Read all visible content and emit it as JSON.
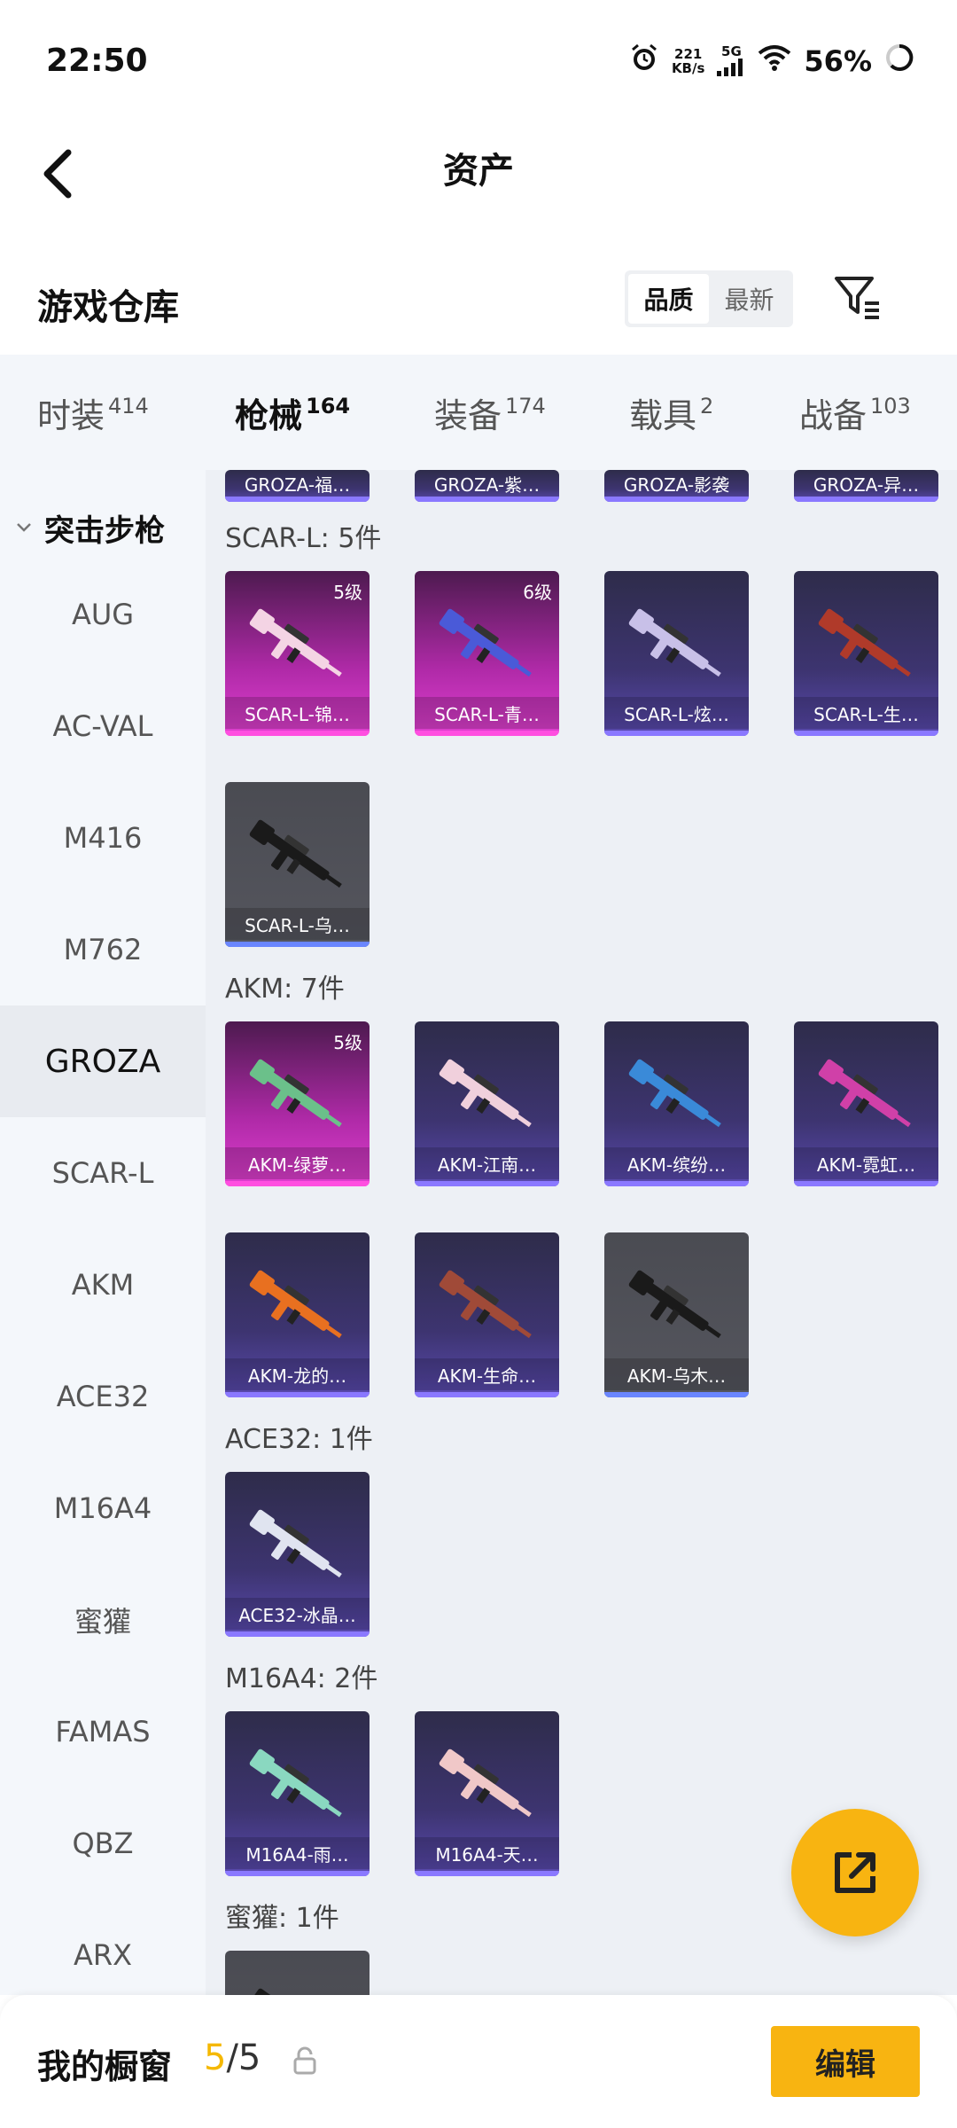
{
  "status": {
    "time": "22:50",
    "speed_top": "221",
    "speed_bottom": "KB/s",
    "network": "5G",
    "battery": "56%"
  },
  "header": {
    "title": "资产"
  },
  "warehouse": {
    "label": "游戏仓库",
    "sort_options": [
      "品质",
      "最新"
    ],
    "active_sort": "品质"
  },
  "tabs": [
    {
      "label": "时装",
      "count": "414"
    },
    {
      "label": "枪械",
      "count": "164"
    },
    {
      "label": "装备",
      "count": "174"
    },
    {
      "label": "载具",
      "count": "2"
    },
    {
      "label": "战备",
      "count": "103"
    }
  ],
  "sidebar": {
    "category": "突击步枪",
    "items": [
      "AUG",
      "AC-VAL",
      "M416",
      "M762",
      "GROZA",
      "SCAR-L",
      "AKM",
      "ACE32",
      "M16A4",
      "蜜獾",
      "FAMAS",
      "QBZ",
      "ARX"
    ],
    "active": "GROZA"
  },
  "content": {
    "top_partial": [
      "GROZA-福…",
      "GROZA-紫…",
      "GROZA-影袭",
      "GROZA-异…"
    ],
    "sections": [
      {
        "title": "SCAR-L: 5件",
        "items": [
          {
            "name": "SCAR-L-锦…",
            "level": "5级",
            "style": "pink",
            "gun_color": "#f4d4e4"
          },
          {
            "name": "SCAR-L-青…",
            "level": "6级",
            "style": "pink",
            "gun_color": "#4a5ad8"
          },
          {
            "name": "SCAR-L-炫…",
            "level": "",
            "style": "purple",
            "gun_color": "#c8c0e8"
          },
          {
            "name": "SCAR-L-生…",
            "level": "",
            "style": "purple",
            "gun_color": "#b03a2a"
          },
          {
            "name": "SCAR-L-乌…",
            "level": "",
            "style": "grey",
            "gun_color": "#1a1a1a"
          }
        ]
      },
      {
        "title": "AKM: 7件",
        "items": [
          {
            "name": "AKM-绿萝…",
            "level": "5级",
            "style": "pink",
            "gun_color": "#6bc08a"
          },
          {
            "name": "AKM-江南…",
            "level": "",
            "style": "purple",
            "gun_color": "#f0d0dc"
          },
          {
            "name": "AKM-缤纷…",
            "level": "",
            "style": "purple",
            "gun_color": "#3a8ad8"
          },
          {
            "name": "AKM-霓虹…",
            "level": "",
            "style": "purple",
            "gun_color": "#d040a8"
          },
          {
            "name": "AKM-龙的…",
            "level": "",
            "style": "purple",
            "gun_color": "#e87020"
          },
          {
            "name": "AKM-生命…",
            "level": "",
            "style": "purple",
            "gun_color": "#a04a38"
          },
          {
            "name": "AKM-乌木…",
            "level": "",
            "style": "grey",
            "gun_color": "#1a1a1a"
          }
        ]
      },
      {
        "title": "ACE32: 1件",
        "items": [
          {
            "name": "ACE32-冰晶…",
            "level": "",
            "style": "purple",
            "gun_color": "#e0e4f0"
          }
        ]
      },
      {
        "title": "M16A4: 2件",
        "items": [
          {
            "name": "M16A4-雨…",
            "level": "",
            "style": "purple",
            "gun_color": "#8ad8c0"
          },
          {
            "name": "M16A4-天…",
            "level": "",
            "style": "purple",
            "gun_color": "#f0c8c8"
          }
        ]
      },
      {
        "title": "蜜獾: 1件",
        "items": [
          {
            "name": "",
            "level": "",
            "style": "grey",
            "gun_color": "#1a1a1a"
          }
        ]
      }
    ]
  },
  "bottom": {
    "label": "我的橱窗",
    "current": "5",
    "total": "/5",
    "edit_label": "编辑"
  },
  "colors": {
    "accent": "#f8b411",
    "underline": "#f5b800"
  }
}
